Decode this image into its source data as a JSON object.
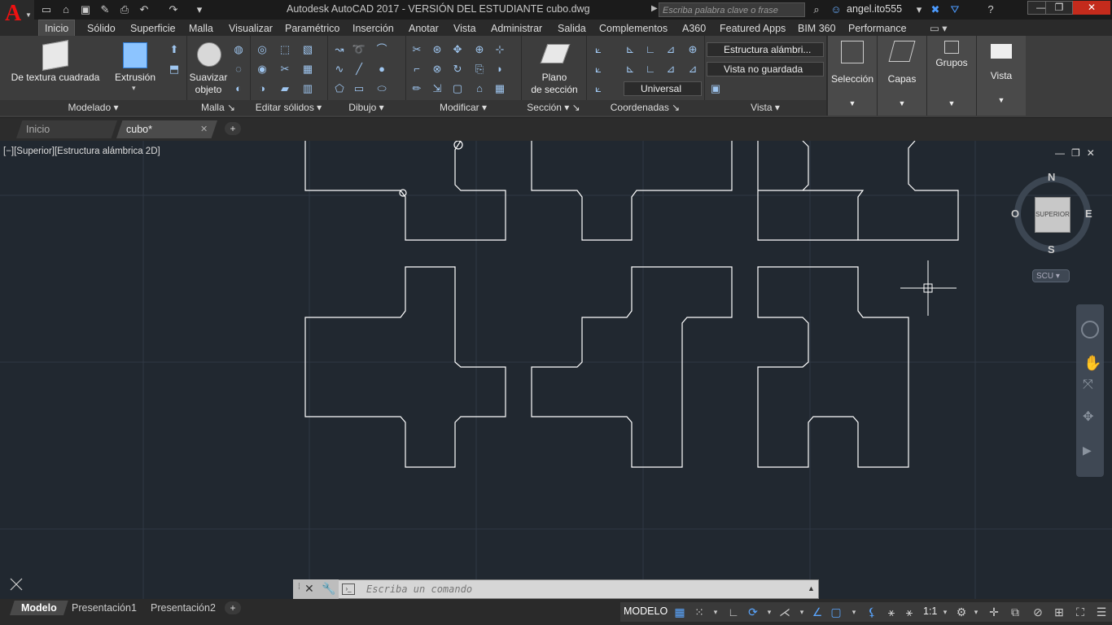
{
  "title": "Autodesk AutoCAD 2017 - VERSIÓN DEL ESTUDIANTE    cubo.dwg",
  "search_placeholder": "Escriba palabra clave o frase",
  "user": "angel.ito555",
  "ribbon_tabs": [
    "Inicio",
    "Sólido",
    "Superficie",
    "Malla",
    "Visualizar",
    "Paramétrico",
    "Inserción",
    "Anotar",
    "Vista",
    "Administrar",
    "Salida",
    "Complementos",
    "A360",
    "Featured Apps",
    "BIM 360",
    "Performance"
  ],
  "big_buttons": {
    "textura": "De textura cuadrada",
    "extrusion": "Extrusión",
    "suavizar": [
      "Suavizar",
      "objeto"
    ],
    "plano": [
      "Plano",
      "de sección"
    ]
  },
  "panels": [
    "Modelado",
    "Malla",
    "Editar sólidos",
    "Dibujo",
    "Modificar",
    "Sección",
    "Coordenadas",
    "Vista"
  ],
  "view": {
    "style": "Estructura alámbri...",
    "saved": "Vista no guardada",
    "ucs": "Universal"
  },
  "side_panels": [
    "Selección",
    "Capas",
    "Grupos",
    "Vista"
  ],
  "file_tabs": [
    "Inicio",
    "cubo*"
  ],
  "viewport_label": "[−][Superior][Estructura alámbrica 2D]",
  "viewcube": {
    "n": "N",
    "s": "S",
    "e": "E",
    "w": "O",
    "face": "SUPERIOR",
    "scu": "SCU"
  },
  "command_placeholder": "Escriba un comando",
  "layout_tabs": [
    "Modelo",
    "Presentación1",
    "Presentación2"
  ],
  "status": {
    "model": "MODELO",
    "scale": "1:1"
  },
  "colors": {
    "viewport": "#212830",
    "ribbon": "#3d3d3d",
    "accent": "#5aa6ff",
    "logo": "#e11111"
  }
}
